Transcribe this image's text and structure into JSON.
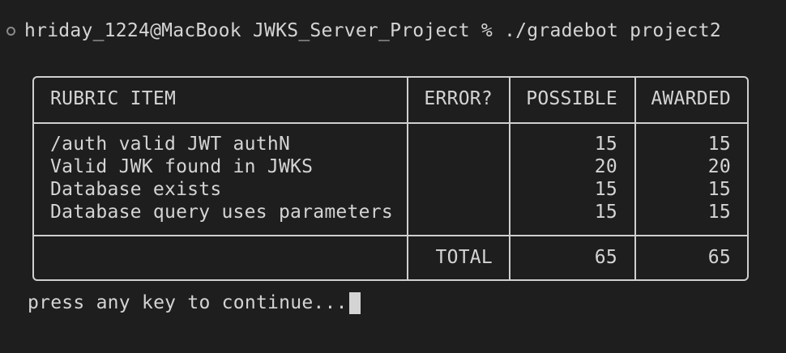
{
  "terminal": {
    "prompt": "hriday_1224@MacBook JWKS_Server_Project % ./gradebot project2",
    "footer_message": "press any key to continue..."
  },
  "rubric": {
    "headers": {
      "item": "RUBRIC ITEM",
      "error": "ERROR?",
      "possible": "POSSIBLE",
      "awarded": "AWARDED"
    },
    "rows": [
      {
        "item": "/auth valid JWT authN",
        "error": "",
        "possible": "15",
        "awarded": "15"
      },
      {
        "item": "Valid JWK found in JWKS",
        "error": "",
        "possible": "20",
        "awarded": "20"
      },
      {
        "item": "Database exists",
        "error": "",
        "possible": "15",
        "awarded": "15"
      },
      {
        "item": "Database query uses parameters",
        "error": "",
        "possible": "15",
        "awarded": "15"
      }
    ],
    "total": {
      "label": "TOTAL",
      "possible": "65",
      "awarded": "65"
    }
  }
}
